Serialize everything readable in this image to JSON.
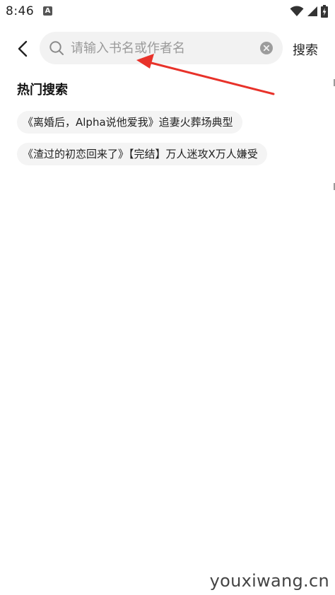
{
  "status_bar": {
    "time": "8:46",
    "notification_icon": "a-app-icon",
    "wifi_icon": "wifi-icon",
    "signal_icon": "signal-icon",
    "battery_icon": "battery-charging-icon"
  },
  "header": {
    "back_icon": "chevron-left-icon",
    "search": {
      "placeholder": "请输入书名或作者名",
      "value": ""
    },
    "clear_icon": "clear-circle-icon",
    "search_button_label": "搜索"
  },
  "hot_search": {
    "title": "热门搜索",
    "items": [
      {
        "label": "《离婚后，Alpha说他爱我》追妻火葬场典型"
      },
      {
        "label": "《渣过的初恋回来了》【完结】万人迷攻X万人嫌受"
      }
    ]
  },
  "annotation": {
    "arrow_color": "#e8322a"
  },
  "watermark": {
    "text": "youxiwang.cn"
  }
}
